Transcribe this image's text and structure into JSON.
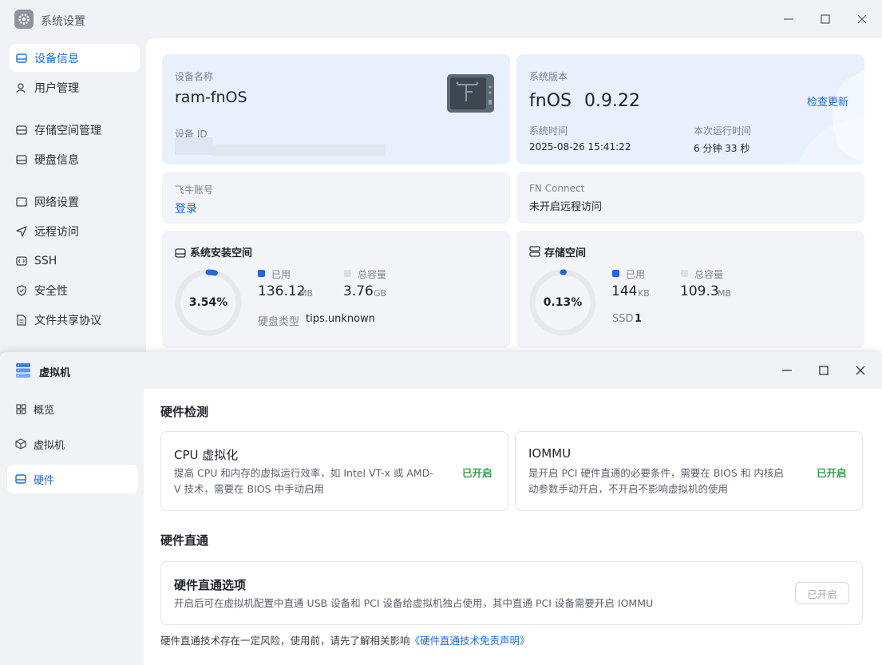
{
  "settings_window": {
    "title": "系统设置",
    "sidebar": [
      {
        "label": "设备信息",
        "active": true
      },
      {
        "label": "用户管理"
      },
      {
        "label": "存储空间管理"
      },
      {
        "label": "硬盘信息"
      },
      {
        "label": "网络设置"
      },
      {
        "label": "远程访问"
      },
      {
        "label": "SSH"
      },
      {
        "label": "安全性"
      },
      {
        "label": "文件共享协议"
      }
    ],
    "device": {
      "name_label": "设备名称",
      "name": "ram-fnOS",
      "id_label": "设备 ID"
    },
    "system": {
      "version_label": "系统版本",
      "os_name": "fnOS",
      "version": "0.9.22",
      "check_update": "检查更新",
      "time_label": "系统时间",
      "time": "2025-08-26 15:41:22",
      "uptime_label": "本次运行时间",
      "uptime": "6 分钟 33 秒"
    },
    "account": {
      "label": "飞牛账号",
      "login": "登录"
    },
    "fn_connect": {
      "label": "FN Connect",
      "status": "未开启远程访问"
    },
    "install_space": {
      "title": "系统安装空间",
      "percent": "3.54%",
      "percent_value": 3.54,
      "used_label": "已用",
      "used_value": "136.12",
      "used_unit": "MB",
      "total_label": "总容量",
      "total_value": "3.76",
      "total_unit": "GB",
      "disk_type_label": "硬盘类型",
      "disk_type": "tips.unknown"
    },
    "storage_space": {
      "title": "存储空间",
      "percent": "0.13%",
      "percent_value": 0.13,
      "used_label": "已用",
      "used_value": "144",
      "used_unit": "KB",
      "total_label": "总容量",
      "total_value": "109.3",
      "total_unit": "MB",
      "ssd_label": "SSD",
      "ssd_count": "1"
    }
  },
  "vm_window": {
    "title": "虚拟机",
    "sidebar": [
      {
        "label": "概览"
      },
      {
        "label": "虚拟机"
      },
      {
        "label": "硬件",
        "active": true
      }
    ],
    "hardware_check": {
      "title": "硬件检测",
      "cpu": {
        "title": "CPU 虚拟化",
        "desc_line1": "提高 CPU 和内存的虚拟运行效率，如 Intel VT-x 或 AMD-",
        "desc_line2": "V 技术，需要在 BIOS 中手动启用",
        "status": "已开启"
      },
      "iommu": {
        "title": "IOMMU",
        "desc_line1": "是开启 PCI 硬件直通的必要条件，需要在 BIOS 和 内核启",
        "desc_line2": "动参数手动开启，不开启不影响虚拟机的使用",
        "status": "已开启"
      }
    },
    "passthrough": {
      "title": "硬件直通",
      "option_title": "硬件直通选项",
      "option_desc": "开启后可在虚拟机配置中直通 USB 设备和 PCI 设备给虚拟机独占使用，其中直通 PCI 设备需要开启 IOMMU",
      "button": "已开启",
      "note": "硬件直通技术存在一定风险，使用前，请先了解相关影响",
      "note_link": "《硬件直通技术免责声明》"
    }
  },
  "colors": {
    "accent": "#2168dd",
    "success": "#2fa04a",
    "ring_track": "#e6e8ec"
  }
}
